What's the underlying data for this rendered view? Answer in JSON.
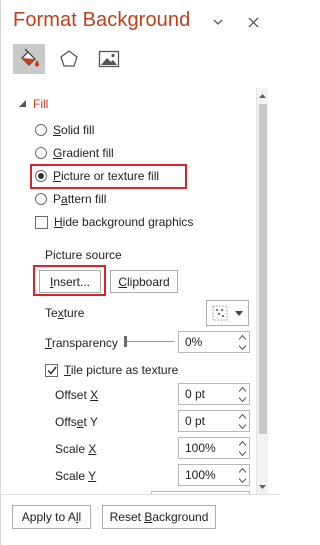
{
  "pane": {
    "title": "Format Background",
    "tabs": [
      {
        "name": "fill-tab",
        "icon": "paint-bucket-icon",
        "selected": true
      },
      {
        "name": "effects-tab",
        "icon": "pentagon-icon",
        "selected": false
      },
      {
        "name": "picture-tab",
        "icon": "picture-icon",
        "selected": false
      }
    ]
  },
  "fill": {
    "section_label": "Fill",
    "options": [
      {
        "pre": "",
        "key": "S",
        "post": "olid fill",
        "checked": false
      },
      {
        "pre": "",
        "key": "G",
        "post": "radient fill",
        "checked": false
      },
      {
        "pre": "",
        "key": "P",
        "post": "icture or texture fill",
        "checked": true
      },
      {
        "pre": "P",
        "key": "a",
        "post": "ttern fill",
        "checked": false
      }
    ],
    "hide_graphics": {
      "key": "H",
      "post": "ide background graphics",
      "checked": false
    },
    "picture_source_label": "Picture source",
    "insert_label": "Insert...",
    "insert_key": "I",
    "clipboard_label": "Clipboard",
    "clipboard_key": "C",
    "texture": {
      "pre": "Te",
      "key": "x",
      "post": "ture"
    },
    "transparency": {
      "key": "T",
      "post": "ransparency",
      "value": "0%",
      "level": 0
    },
    "tile": {
      "key": "T",
      "post": "ile picture as texture",
      "checked": true
    },
    "offset_x": {
      "pre": "Offset ",
      "key": "X",
      "post": "",
      "value": "0 pt"
    },
    "offset_y": {
      "pre": "Offs",
      "key": "e",
      "post": "t Y",
      "value": "0 pt"
    },
    "scale_x": {
      "pre": "Scale ",
      "key": "X",
      "post": "",
      "value": "100%"
    },
    "scale_y": {
      "pre": "Scale ",
      "key": "Y",
      "post": "",
      "value": "100%"
    }
  },
  "footer": {
    "apply_all": {
      "pre": "Apply to A",
      "key": "l",
      "post": "l"
    },
    "reset": {
      "pre": "Reset ",
      "key": "B",
      "post": "ackground"
    }
  },
  "colors": {
    "accent": "#c43e1c",
    "highlight": "#d9232d"
  }
}
